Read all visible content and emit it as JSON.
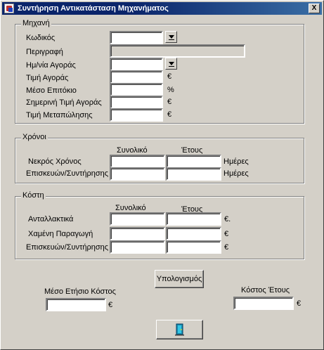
{
  "window": {
    "title": "Συντήρηση Αντικατάσταση Μηχανήματος",
    "close_label": "X"
  },
  "machine": {
    "legend": "Μηχανή",
    "code_label": "Κωδικός",
    "description_label": "Περιγραφή",
    "purchase_date_label": "Ημ/νία Αγοράς",
    "purchase_price_label": "Τιμή Αγοράς",
    "avg_interest_label": "Μέσο Επιτόκιο",
    "current_price_label": "Σημερινή Τιμή Αγοράς",
    "resale_price_label": "Τιμή Μεταπώλησης",
    "currency": "€",
    "percent": "%"
  },
  "times": {
    "legend": "Χρόνοι",
    "col_total": "Συνολικό",
    "col_year": "Έτους",
    "dead_time_label": "Νεκρός Χρόνος",
    "repair_label": "Επισκευών/Συντήρησης",
    "unit": "Ημέρες"
  },
  "costs": {
    "legend": "Κόστη",
    "col_total": "Συνολικό",
    "col_year": "Έτους",
    "spare_parts_label": "Ανταλλακτικά",
    "lost_production_label": "Χαμένη Παραγωγή",
    "repair_label": "Επισκευών/Συντήρησης",
    "spare_parts_unit": "€.",
    "currency": "€"
  },
  "summary": {
    "calculate_label": "Υπολογισμός",
    "avg_annual_cost_label": "Μέσο Ετήσιο Κόστος",
    "year_cost_label": "Κόστος Έτους",
    "currency": "€"
  },
  "icons": {
    "exit": "exit-door-icon",
    "dropdown": "dropdown-arrow-icon"
  }
}
